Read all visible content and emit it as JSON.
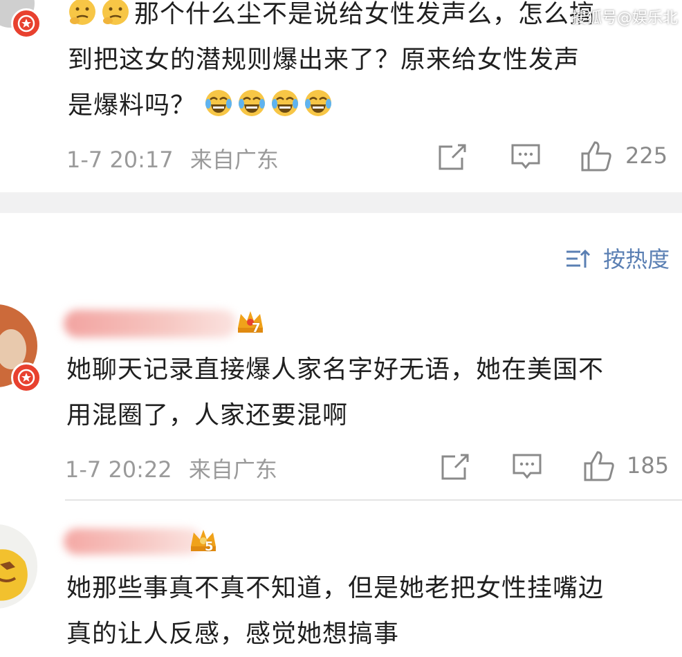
{
  "watermark": "搜狐号@娱乐北",
  "comments": [
    {
      "text_line1": "那个什么尘不是说给女性发声么，怎么搞",
      "text_line2": "到把这女的潜规则爆出来了？原来给女性发声",
      "text_line3": "是爆料吗？",
      "time": "1-7 20:17",
      "location": "来自广东",
      "likes": "225"
    },
    {
      "user_level": "7",
      "text_line1": "她聊天记录直接爆人家名字好无语，她在美国不",
      "text_line2": "用混圈了，人家还要混啊",
      "time": "1-7 20:22",
      "location": "来自广东",
      "likes": "185"
    },
    {
      "user_level": "5",
      "text_line1": "她那些事真不真不知道，但是她老把女性挂嘴边",
      "text_line2": "真的让人反感，感觉她想搞事"
    }
  ],
  "sort": {
    "label": "按热度"
  },
  "colors": {
    "accent": "#5a7fb3",
    "badge": "#e8412f",
    "crown": "#f0a21a",
    "meta_text": "#9a9a9a"
  },
  "icons": [
    "thinking-emoji",
    "laugh-cry-emoji",
    "share-icon",
    "comment-icon",
    "like-icon",
    "sort-icon",
    "crown-icon"
  ]
}
